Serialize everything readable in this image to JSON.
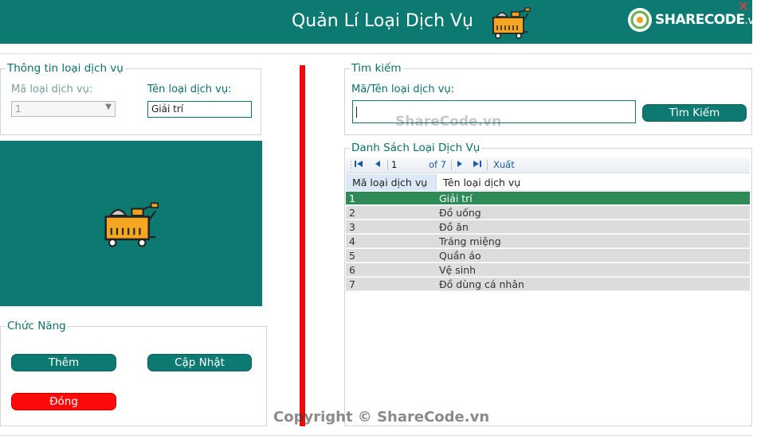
{
  "header": {
    "title": "Quản Lí Loại Dịch Vụ",
    "logo_main": "SHARECODE",
    "logo_suffix": ".vn",
    "close_glyph": "✕",
    "bg_color": "#0d7a72"
  },
  "info_group": {
    "legend": "Thông tin loại dịch vụ",
    "code_label": "Mã loại dịch vụ:",
    "code_value": "1",
    "name_label": "Tên loại dịch vụ:",
    "name_value": "Giải trí"
  },
  "function_group": {
    "legend": "Chức Năng",
    "add_label": "Thêm",
    "update_label": "Cập Nhật",
    "close_label": "Đóng"
  },
  "search_group": {
    "legend": "Tìm kiếm",
    "field_label": "Mã/Tên loại dịch vụ:",
    "field_value": "",
    "search_button": "Tìm Kiếm"
  },
  "list_group": {
    "legend": "Danh Sách Loại Dịch Vụ",
    "navigator": {
      "position": "1",
      "of_text": "of 7",
      "export_label": "Xuất"
    },
    "columns": [
      "Mã loại dịch vụ",
      "Tên loại dịch vụ"
    ],
    "rows": [
      {
        "code": "1",
        "name": "Giải trí"
      },
      {
        "code": "2",
        "name": "Đồ uống"
      },
      {
        "code": "3",
        "name": "Đồ ăn"
      },
      {
        "code": "4",
        "name": "Tráng miệng"
      },
      {
        "code": "5",
        "name": "Quần áo"
      },
      {
        "code": "6",
        "name": "Vệ sinh"
      },
      {
        "code": "7",
        "name": "Đồ dùng cá nhân"
      }
    ],
    "selected_row": 0
  },
  "watermarks": {
    "middle": "ShareCode.vn",
    "footer": "Copyright © ShareCode.vn"
  },
  "colors": {
    "accent": "#0d7a72",
    "danger": "#ff0a0a",
    "selected_row": "#2e8b57"
  },
  "icons": [
    "food-cart-icon",
    "close-icon",
    "first-page-icon",
    "prev-page-icon",
    "next-page-icon",
    "last-page-icon",
    "dropdown-arrow-icon"
  ]
}
